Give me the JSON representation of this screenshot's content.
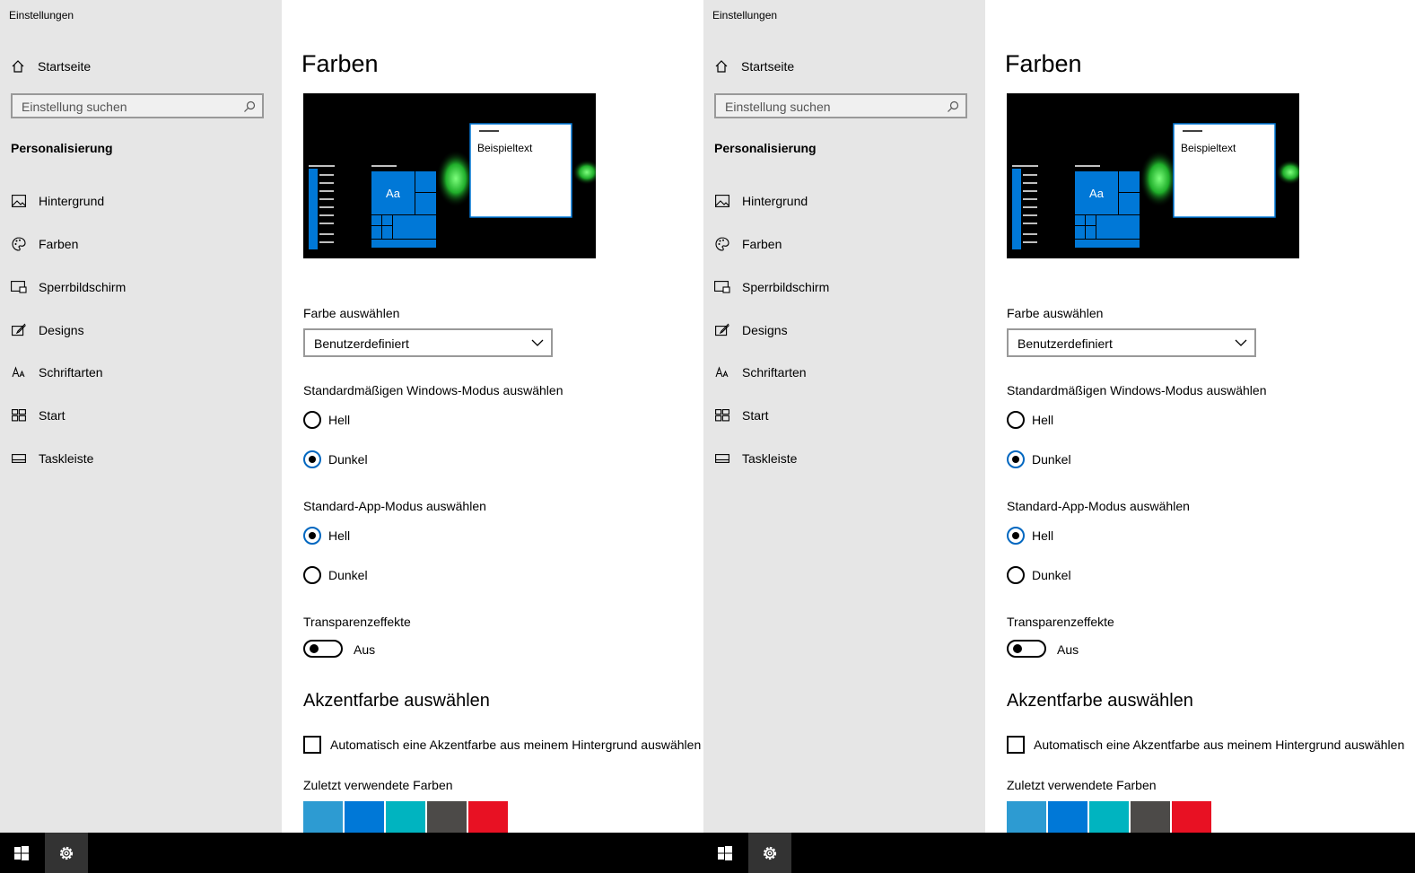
{
  "windows": [
    {
      "app_title": "Einstellungen",
      "home_label": "Startseite",
      "search_placeholder": "Einstellung suchen",
      "section_label": "Personalisierung",
      "nav": [
        {
          "label": "Hintergrund",
          "icon": "picture-icon"
        },
        {
          "label": "Farben",
          "icon": "palette-icon"
        },
        {
          "label": "Sperrbildschirm",
          "icon": "lock-screen-icon"
        },
        {
          "label": "Designs",
          "icon": "brush-icon"
        },
        {
          "label": "Schriftarten",
          "icon": "font-icon"
        },
        {
          "label": "Start",
          "icon": "start-tiles-icon"
        },
        {
          "label": "Taskleiste",
          "icon": "taskbar-icon"
        }
      ],
      "page_title": "Farben",
      "preview": {
        "sample_text": "Beispieltext",
        "tile_text": "Aa"
      },
      "color_select": {
        "label": "Farbe auswählen",
        "value": "Benutzerdefiniert"
      },
      "windows_mode": {
        "label": "Standardmäßigen Windows-Modus auswählen",
        "options": [
          "Hell",
          "Dunkel"
        ],
        "selected": "Dunkel"
      },
      "app_mode": {
        "label": "Standard-App-Modus auswählen",
        "options": [
          "Hell",
          "Dunkel"
        ],
        "selected": "Hell"
      },
      "transparency": {
        "label": "Transparenzeffekte",
        "state": "Aus"
      },
      "accent_heading": "Akzentfarbe auswählen",
      "auto_accent_label": "Automatisch eine Akzentfarbe aus meinem Hintergrund auswählen",
      "recent_colors_label": "Zuletzt verwendete Farben",
      "recent_colors": [
        "#2d9bd2",
        "#0078d7",
        "#00b4c0",
        "#4c4a48",
        "#e81123"
      ]
    },
    {
      "app_title": "Einstellungen",
      "home_label": "Startseite",
      "search_placeholder": "Einstellung suchen",
      "section_label": "Personalisierung",
      "nav": [
        {
          "label": "Hintergrund",
          "icon": "picture-icon"
        },
        {
          "label": "Farben",
          "icon": "palette-icon"
        },
        {
          "label": "Sperrbildschirm",
          "icon": "lock-screen-icon"
        },
        {
          "label": "Designs",
          "icon": "brush-icon"
        },
        {
          "label": "Schriftarten",
          "icon": "font-icon"
        },
        {
          "label": "Start",
          "icon": "start-tiles-icon"
        },
        {
          "label": "Taskleiste",
          "icon": "taskbar-icon"
        }
      ],
      "page_title": "Farben",
      "preview": {
        "sample_text": "Beispieltext",
        "tile_text": "Aa"
      },
      "color_select": {
        "label": "Farbe auswählen",
        "value": "Benutzerdefiniert"
      },
      "windows_mode": {
        "label": "Standardmäßigen Windows-Modus auswählen",
        "options": [
          "Hell",
          "Dunkel"
        ],
        "selected": "Dunkel"
      },
      "app_mode": {
        "label": "Standard-App-Modus auswählen",
        "options": [
          "Hell",
          "Dunkel"
        ],
        "selected": "Hell"
      },
      "transparency": {
        "label": "Transparenzeffekte",
        "state": "Aus"
      },
      "accent_heading": "Akzentfarbe auswählen",
      "auto_accent_label": "Automatisch eine Akzentfarbe aus meinem Hintergrund auswählen",
      "recent_colors_label": "Zuletzt verwendete Farben",
      "recent_colors": [
        "#2d9bd2",
        "#0078d7",
        "#00b4c0",
        "#4c4a48",
        "#e81123"
      ]
    }
  ],
  "taskbar": {
    "start_icon": "windows-logo-icon",
    "settings_icon": "gear-icon"
  }
}
